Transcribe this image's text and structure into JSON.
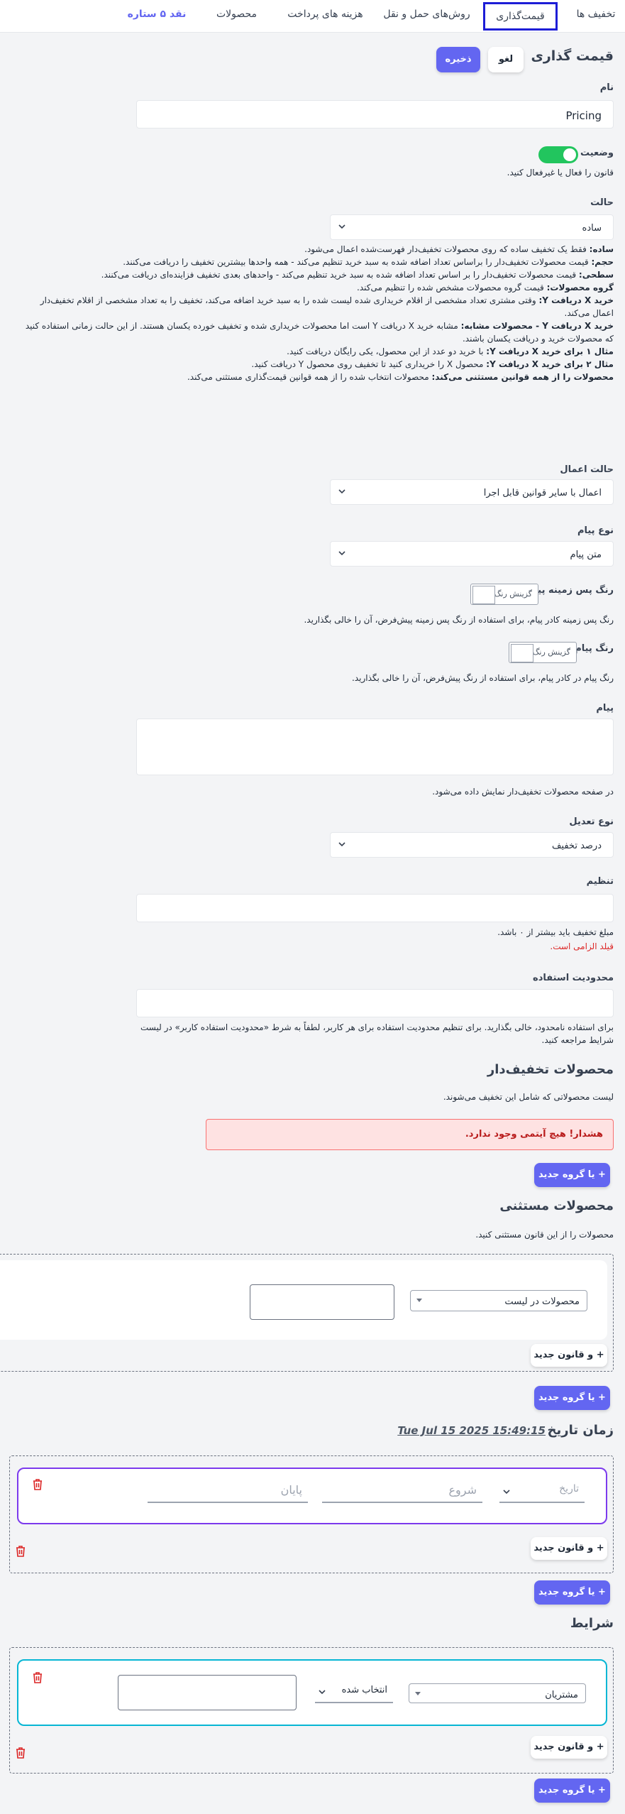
{
  "tabs": [
    {
      "label": "تخفیف ها"
    },
    {
      "label": "قیمت‌گذاری"
    },
    {
      "label": "روش‌های حمل و نقل"
    },
    {
      "label": "هزینه های پرداخت"
    },
    {
      "label": "محصولات"
    },
    {
      "label": "نقد ۵ ستاره"
    }
  ],
  "header": {
    "title": "قیمت گذاری",
    "cancel_label": "لغو",
    "save_label": "ذخیره"
  },
  "name_field": {
    "label": "نام",
    "value": "Pricing"
  },
  "status": {
    "label": "وضعیت",
    "help": "قانون را فعال یا غیرفعال کنید.",
    "enabled": true
  },
  "mode": {
    "label": "حالت",
    "value": "ساده",
    "help": [
      {
        "b": "ساده:",
        "t": " فقط یک تخفیف ساده که روی محصولات تخفیف‌دار فهرست‌شده اعمال می‌شود."
      },
      {
        "b": "حجم:",
        "t": " قیمت محصولات تخفیف‌دار را براساس تعداد اضافه شده به سبد خرید تنظیم می‌کند - همه واحدها بیشترین تخفیف را دریافت می‌کنند."
      },
      {
        "b": "سطحی:",
        "t": " قیمت محصولات تخفیف‌دار را بر اساس تعداد اضافه شده به سبد خرید تنظیم می‌کند - واحدهای بعدی تخفیف فزاینده‌ای دریافت می‌کنند."
      },
      {
        "b": "گروه محصولات:",
        "t": " قیمت گروه محصولات مشخص شده را تنظیم می‌کند."
      },
      {
        "b": "خرید X دریافت Y:",
        "t": " وقتی مشتری تعداد مشخصی از اقلام خریداری شده لیست شده را به سبد خرید اضافه می‌کند، تخفیف را به تعداد مشخصی از اقلام تخفیف‌دار اعمال می‌کند."
      },
      {
        "b": "خرید X دریافت Y - محصولات مشابه:",
        "t": " مشابه خرید X دریافت Y است اما محصولات خریداری شده و تخفیف خورده یکسان هستند. از این حالت زمانی استفاده کنید که محصولات خرید و دریافت یکسان باشند."
      },
      {
        "b": "مثال ۱ برای خرید X دریافت Y:",
        "t": " با خرید دو عدد از این محصول، یکی رایگان دریافت کنید."
      },
      {
        "b": "مثال ۲ برای خرید X دریافت Y:",
        "t": " محصول X را خریداری کنید تا تخفیف روی محصول Y دریافت کنید."
      },
      {
        "b": "محصولات را از همه قوانین مستثنی می‌کند:",
        "t": " محصولات انتخاب شده را از همه قوانین قیمت‌گذاری مستثنی می‌کند."
      }
    ]
  },
  "apply_mode": {
    "label": "حالت اعمال",
    "value": "اعمال با سایر قوانین قابل اجرا"
  },
  "message_type": {
    "label": "نوع پیام",
    "value": "متن پیام"
  },
  "message_bg_color": {
    "label": "رنگ پس زمینه پیام",
    "picker": "گزینش رنگ",
    "help": "رنگ پس زمینه کادر پیام، برای استفاده از رنگ پس زمینه پیش‌فرض، آن را خالی بگذارید."
  },
  "message_color": {
    "label": "رنگ پیام",
    "picker": "گزینش رنگ",
    "help": "رنگ پیام در کادر پیام، برای استفاده از رنگ پیش‌فرض، آن را خالی بگذارید."
  },
  "message": {
    "label": "پیام",
    "help": "در صفحه محصولات تخفیف‌دار نمایش داده می‌شود."
  },
  "adjustment_type": {
    "label": "نوع تعدیل",
    "value": "درصد تخفیف"
  },
  "adjustment": {
    "label": "تنظیم",
    "help": "مبلغ تخفیف باید بیشتر از ۰ باشد.",
    "error": "قیلد الزامی است."
  },
  "usage_limit": {
    "label": "محدودیت استفاده",
    "help": "برای استفاده نامحدود، خالی بگذارید. برای تنظیم محدودیت استفاده برای هر کاربر، لطفاً به شرط «محدودیت استفاده کاربر» در لیست شرایط مراجعه کنید."
  },
  "discounted_products": {
    "title": "محصولات تخفیف‌دار",
    "subtitle": "لیست محصولاتی که شامل این تخفیف می‌شوند.",
    "alert": "هشدار! هیچ آیتمی وجود ندارد.",
    "add_group": "+ یا گروه جدید"
  },
  "excluded_products": {
    "title": "محصولات مستثنی",
    "subtitle": "محصولات را از این قانون مستثنی کنید.",
    "select_value": "محصولات در لیست",
    "add_rule": "+ و قانون جدید",
    "add_group": "+ یا گروه جدید"
  },
  "datetime": {
    "title": "زمان تاریخ",
    "current": "Tue Jul 15 2025 15:49:15",
    "type_value": "تاریخ",
    "start_placeholder": "شروع",
    "end_placeholder": "پایان",
    "add_rule": "+ و قانون جدید",
    "add_group": "+ یا گروه جدید"
  },
  "conditions": {
    "title": "شرایط",
    "type_value": "مشتریان",
    "op_value": "انتخاب شده",
    "add_rule": "+ و قانون جدید",
    "add_group": "+ یا گروه جدید"
  },
  "colors": {
    "accent": "#6366f1",
    "toggle": "#22c55e",
    "error": "#dc2626",
    "purple": "#7c3aed",
    "cyan": "#06b6d4"
  }
}
